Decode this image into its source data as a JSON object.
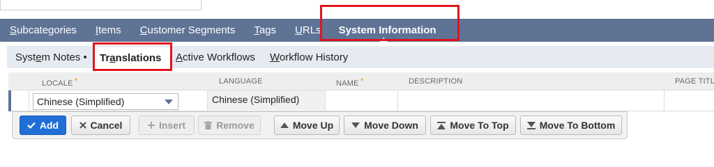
{
  "main_tabs": [
    {
      "lead": "S",
      "rest": "ubcategories"
    },
    {
      "lead": "I",
      "rest": "tems"
    },
    {
      "lead": "C",
      "rest": "ustomer Segments"
    },
    {
      "lead": "T",
      "rest": "ags"
    },
    {
      "lead": "U",
      "rest": "RLs"
    },
    {
      "label": "System Information"
    }
  ],
  "sub_tabs": [
    {
      "pre": "Syst",
      "u": "e",
      "post": "m Notes •"
    },
    {
      "pre": "Tr",
      "u": "a",
      "post": "nslations"
    },
    {
      "pre": "",
      "u": "A",
      "post": "ctive Workflows"
    },
    {
      "pre": "",
      "u": "W",
      "post": "orkflow History"
    }
  ],
  "columns": {
    "locale": "LOCALE",
    "language": "LANGUAGE",
    "name": "NAME",
    "description": "DESCRIPTION",
    "page_title": "PAGE TITLE"
  },
  "required_marker": "*",
  "row": {
    "locale": "Chinese (Simplified)",
    "language": "Chinese (Simplified)"
  },
  "buttons": {
    "add": "Add",
    "cancel": "Cancel",
    "insert": "Insert",
    "remove": "Remove",
    "move_up": "Move Up",
    "move_down": "Move Down",
    "move_to_top": "Move To Top",
    "move_to_bottom": "Move To Bottom"
  },
  "colors": {
    "tab_bar": "#5f7395",
    "subtab_bar": "#e6ebf2",
    "primary_button": "#1f6fd6",
    "highlight": "#e0141e",
    "required": "#e9a21e"
  }
}
